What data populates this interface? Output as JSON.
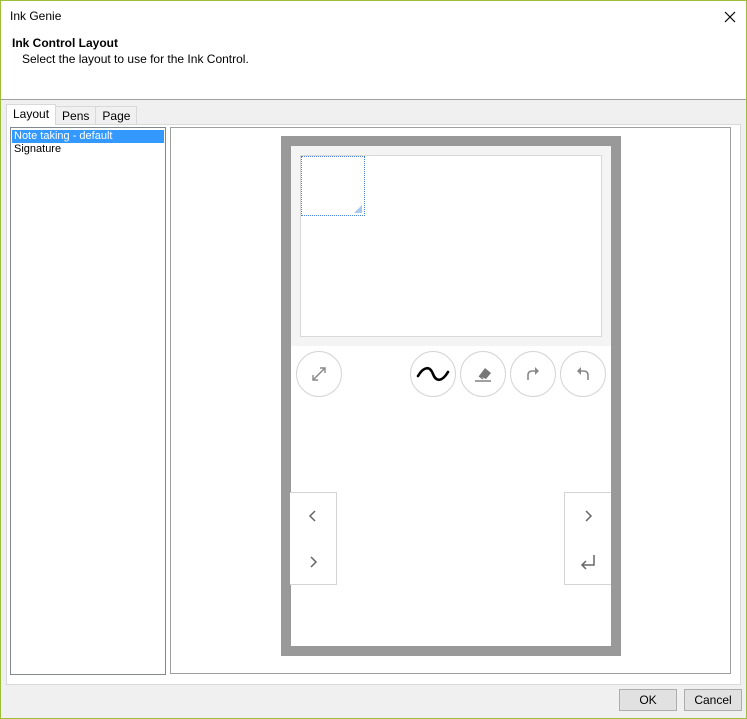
{
  "window": {
    "title": "Ink Genie"
  },
  "header": {
    "title": "Ink Control Layout",
    "subtitle": "Select the layout to use for the Ink Control."
  },
  "tabs": [
    {
      "label": "Layout",
      "active": true
    },
    {
      "label": "Pens",
      "active": false
    },
    {
      "label": "Page",
      "active": false
    }
  ],
  "layouts": {
    "items": [
      {
        "label": "Note taking - default",
        "selected": true
      },
      {
        "label": "Signature",
        "selected": false
      }
    ]
  },
  "preview": {
    "toolbar_icons": [
      "expand-icon",
      "pen-stroke-icon",
      "eraser-icon",
      "redo-icon",
      "undo-icon"
    ],
    "left_nav_icons": [
      "chevron-left-icon",
      "chevron-right-icon"
    ],
    "right_nav_icons": [
      "chevron-right-icon",
      "enter-icon"
    ]
  },
  "footer": {
    "ok_label": "OK",
    "cancel_label": "Cancel"
  },
  "colors": {
    "selection": "#3399ff",
    "device_frame": "#999999",
    "window_border": "#9bbf3a"
  }
}
